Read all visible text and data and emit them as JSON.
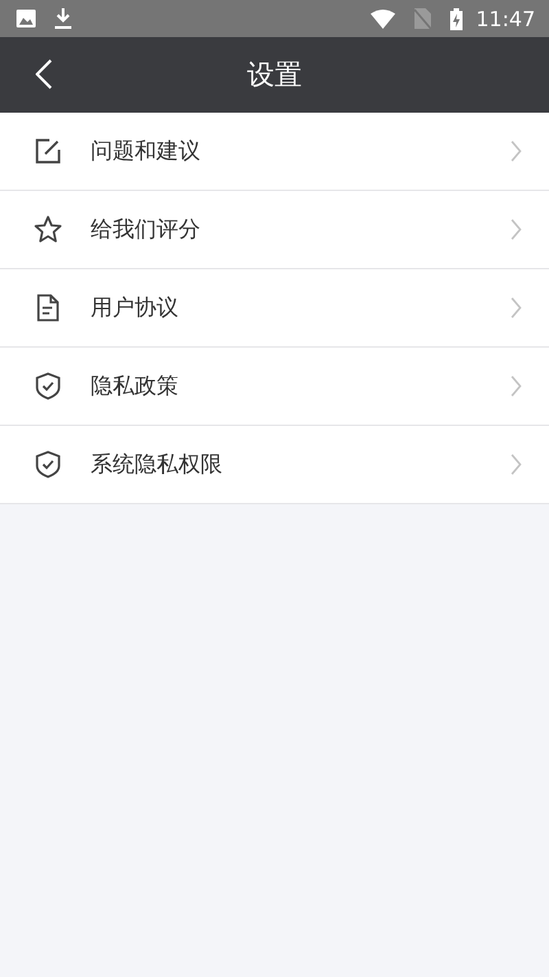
{
  "status_bar": {
    "time": "11:47"
  },
  "header": {
    "title": "设置"
  },
  "items": [
    {
      "kind": "edit",
      "label": "问题和建议"
    },
    {
      "kind": "star",
      "label": "给我们评分"
    },
    {
      "kind": "document",
      "label": "用户协议"
    },
    {
      "kind": "shield",
      "label": "隐私政策"
    },
    {
      "kind": "shield",
      "label": "系统隐私权限"
    }
  ]
}
